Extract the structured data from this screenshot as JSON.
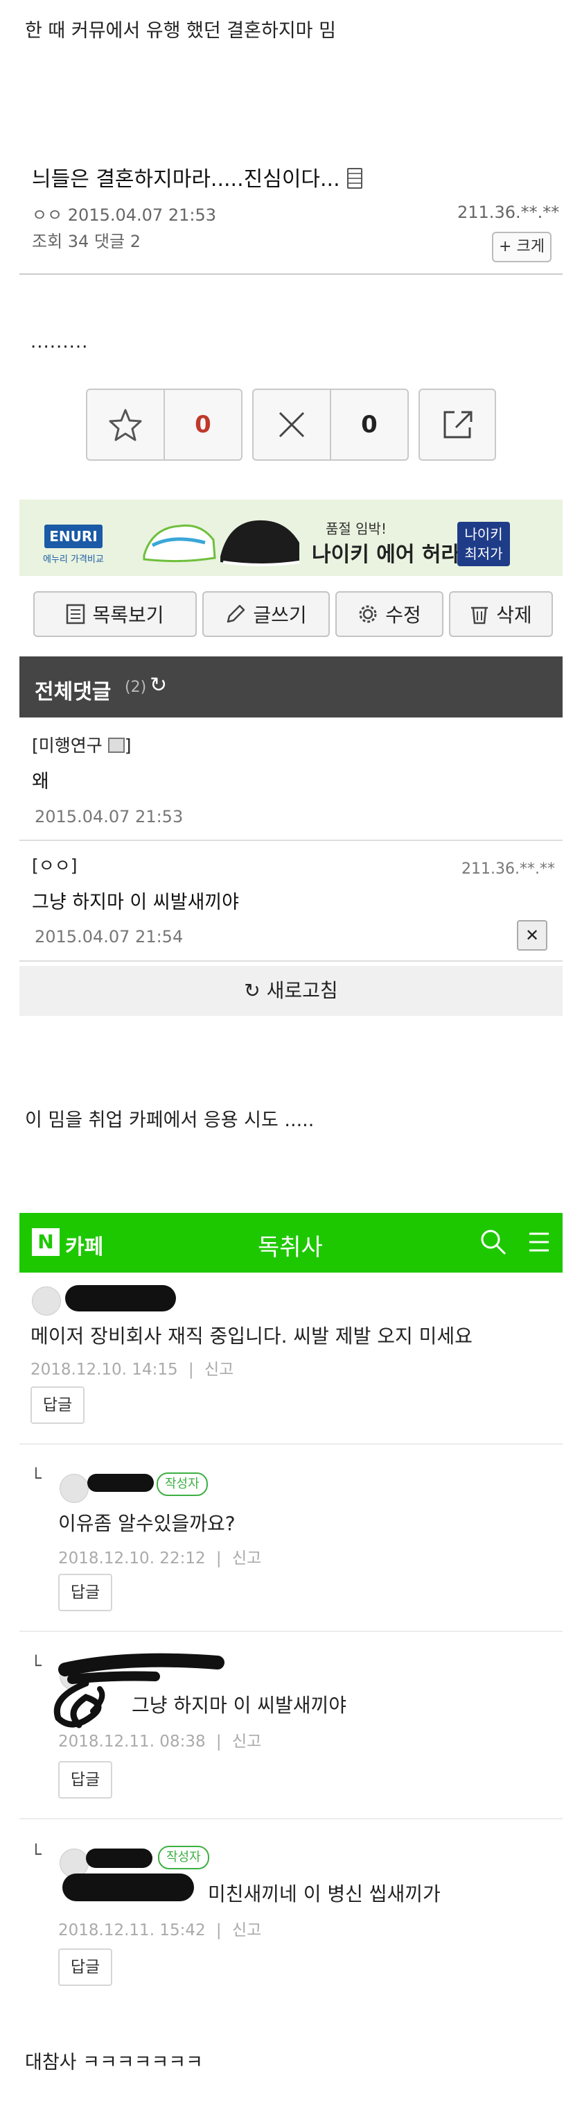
{
  "captions": {
    "top": "한 때 커뮤에서 유행 했던 결혼하지마 밈",
    "middle": "이 밈을 취업 카페에서 응용 시도 .....",
    "bottom": "대참사 ㅋㅋㅋㅋㅋㅋㅋ"
  },
  "post": {
    "title": "늬들은 결혼하지마라.....진심이다...",
    "author_date": "ㅇㅇ 2015.04.07 21:53",
    "ip": "211.36.**.**",
    "stats": "조회 34  댓글 2",
    "enlarge_label": "+ 크게",
    "body": "........."
  },
  "votes": {
    "up_count": "0",
    "down_count": "0"
  },
  "ad": {
    "logo": "ENURI",
    "logo_sub": "에누리 가격비교",
    "line1": "품절 임박!",
    "line2": "나이키 에어 허라취",
    "badge": "나이키 최저가"
  },
  "toolbar": {
    "list_label": "목록보기",
    "write_label": "글쓰기",
    "edit_label": "수정",
    "delete_label": "삭제"
  },
  "comments_header": {
    "title": "전체댓글",
    "count": "(2)"
  },
  "comments": [
    {
      "name": "[미행연구",
      "name_end": "]",
      "body": "왜",
      "date": "2015.04.07 21:53"
    },
    {
      "name": "[ㅇㅇ]",
      "ip": "211.36.**.**",
      "body": "그냥 하지마 이 씨발새끼야",
      "date": "2015.04.07 21:54"
    }
  ],
  "refresh_label": "새로고침",
  "cafe": {
    "label": "카페",
    "title": "독취사",
    "colors": {
      "brand": "#1ec800"
    }
  },
  "replies": [
    {
      "body": "메이저 장비회사 재직 중입니다. 씨발 제발 오지 미세요",
      "date": "2018.12.10. 14:15",
      "report": "신고",
      "reply_label": "답글"
    },
    {
      "badge": "작성자",
      "body": "이유좀 알수있을까요?",
      "date": "2018.12.10. 22:12",
      "report": "신고",
      "reply_label": "답글"
    },
    {
      "body": "그냥 하지마 이 씨발새끼야",
      "date": "2018.12.11. 08:38",
      "report": "신고",
      "reply_label": "답글"
    },
    {
      "badge": "작성자",
      "body": "미친새끼네 이 병신 씹새끼가",
      "date": "2018.12.11. 15:42",
      "report": "신고",
      "reply_label": "답글"
    }
  ]
}
